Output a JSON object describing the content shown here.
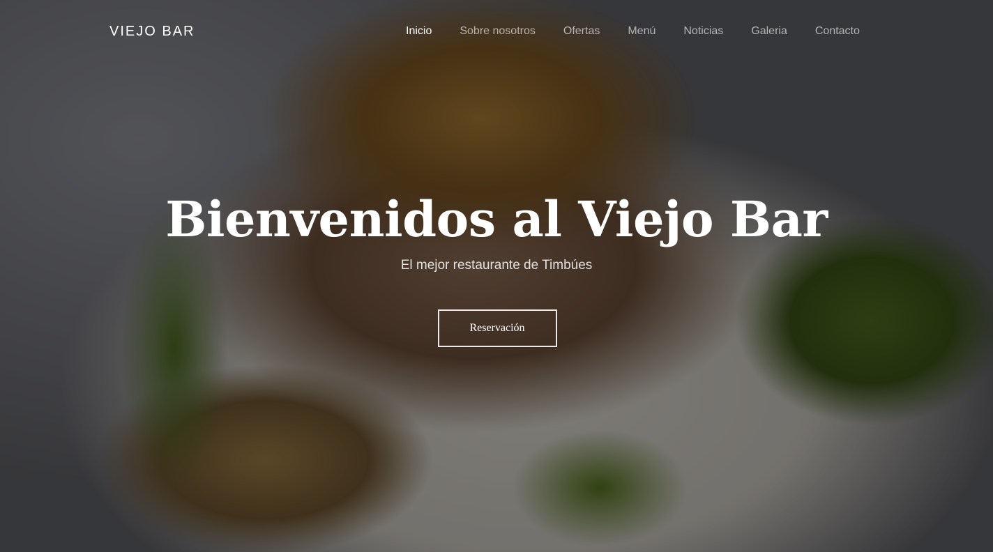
{
  "navbar": {
    "brand": "VIEJO BAR",
    "links": [
      {
        "label": "Inicio",
        "active": true
      },
      {
        "label": "Sobre nosotros",
        "active": false
      },
      {
        "label": "Ofertas",
        "active": false
      },
      {
        "label": "Menú",
        "active": false
      },
      {
        "label": "Noticias",
        "active": false
      },
      {
        "label": "Galeria",
        "active": false
      },
      {
        "label": "Contacto",
        "active": false
      }
    ]
  },
  "hero": {
    "title": "Bienvenidos al Viejo Bar",
    "subtitle": "El mejor restaurante de Timbúes",
    "button_label": "Reservación"
  },
  "colors": {
    "overlay": "#000000",
    "text": "#ffffff"
  }
}
